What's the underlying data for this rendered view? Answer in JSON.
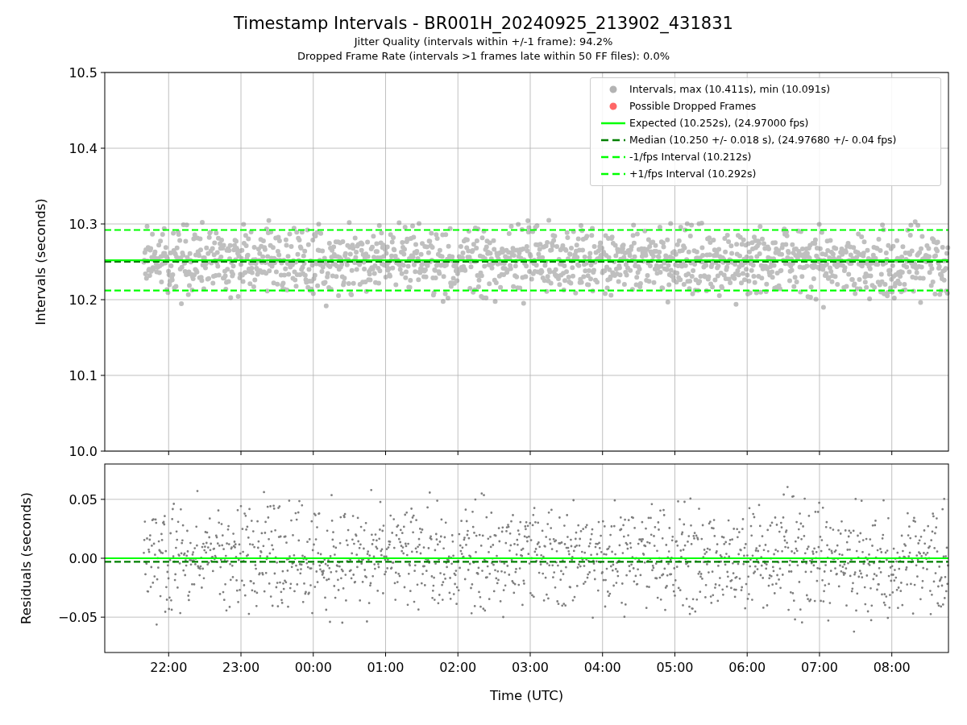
{
  "title": "Timestamp Intervals - BR001H_20240925_213902_431831",
  "subtitles": [
    "Jitter Quality (intervals within +/-1 frame): 94.2%",
    "Dropped Frame Rate (intervals >1 frames late within 50 FF files): 0.0%"
  ],
  "charts": [
    {
      "legend": [
        {
          "kind": "dot",
          "color": "#b3b3b3",
          "label": "Intervals, max (10.411s), min (10.091s)"
        },
        {
          "kind": "dot",
          "color": "#ff6666",
          "label": "Possible Dropped Frames"
        }
      ],
      "chart_data": {
        "type": "line",
        "ylabel": "Intervals (seconds)",
        "grid": true,
        "x": [
          "2024-09-25 21:07",
          "2024-09-26 08:47"
        ],
        "xlim": [
          "2024-09-25 21:07",
          "2024-09-26 08:47"
        ],
        "ylim": [
          10.0,
          10.5
        ],
        "yticks": [
          {
            "value": 10.0,
            "label": "10.0"
          },
          {
            "value": 10.1,
            "label": "10.1"
          },
          {
            "value": 10.2,
            "label": "10.2"
          },
          {
            "value": 10.3,
            "label": "10.3"
          },
          {
            "value": 10.4,
            "label": "10.4"
          },
          {
            "value": 10.5,
            "label": "10.5"
          }
        ],
        "series": [
          {
            "name": "Expected (10.252s), (24.97000 fps)",
            "color": "#00ff00",
            "line_style": "solid",
            "values": [
              10.252,
              10.252
            ]
          },
          {
            "name": "Median (10.250 +/- 0.018 s), (24.97680 +/- 0.04 fps)",
            "color": "#008000",
            "line_style": "dashed",
            "values": [
              10.25,
              10.25
            ]
          },
          {
            "name": "-1/fps Interval (10.212s)",
            "color": "#00ff00",
            "line_style": "dashed",
            "values": [
              10.212,
              10.212
            ]
          },
          {
            "name": "+1/fps Interval (10.292s)",
            "color": "#00ff00",
            "line_style": "dashed",
            "values": [
              10.292,
              10.292
            ]
          }
        ]
      }
    },
    {
      "chart_data": {
        "type": "line",
        "xlabel": "Time (UTC)",
        "ylabel": "Residuals (seconds)",
        "grid": true,
        "x": [
          "2024-09-25 21:07",
          "2024-09-26 08:47"
        ],
        "xlim": [
          "2024-09-25 21:07",
          "2024-09-26 08:47"
        ],
        "ylim": [
          -0.08,
          0.08
        ],
        "xticks": [
          {
            "value": "2024-09-25 22:00",
            "label": "22:00"
          },
          {
            "value": "2024-09-25 23:00",
            "label": "23:00"
          },
          {
            "value": "2024-09-26 00:00",
            "label": "00:00"
          },
          {
            "value": "2024-09-26 01:00",
            "label": "01:00"
          },
          {
            "value": "2024-09-26 02:00",
            "label": "02:00"
          },
          {
            "value": "2024-09-26 03:00",
            "label": "03:00"
          },
          {
            "value": "2024-09-26 04:00",
            "label": "04:00"
          },
          {
            "value": "2024-09-26 05:00",
            "label": "05:00"
          },
          {
            "value": "2024-09-26 06:00",
            "label": "06:00"
          },
          {
            "value": "2024-09-26 07:00",
            "label": "07:00"
          },
          {
            "value": "2024-09-26 08:00",
            "label": "08:00"
          }
        ],
        "yticks": [
          {
            "value": -0.05,
            "label": "−0.05"
          },
          {
            "value": 0.0,
            "label": "0.00"
          },
          {
            "value": 0.05,
            "label": "0.05"
          }
        ],
        "series": [
          {
            "color": "#00ff00",
            "line_style": "solid",
            "values": [
              0.0,
              0.0
            ]
          },
          {
            "color": "#008000",
            "line_style": "dashed",
            "values": [
              -0.003,
              -0.003
            ]
          }
        ]
      }
    }
  ]
}
